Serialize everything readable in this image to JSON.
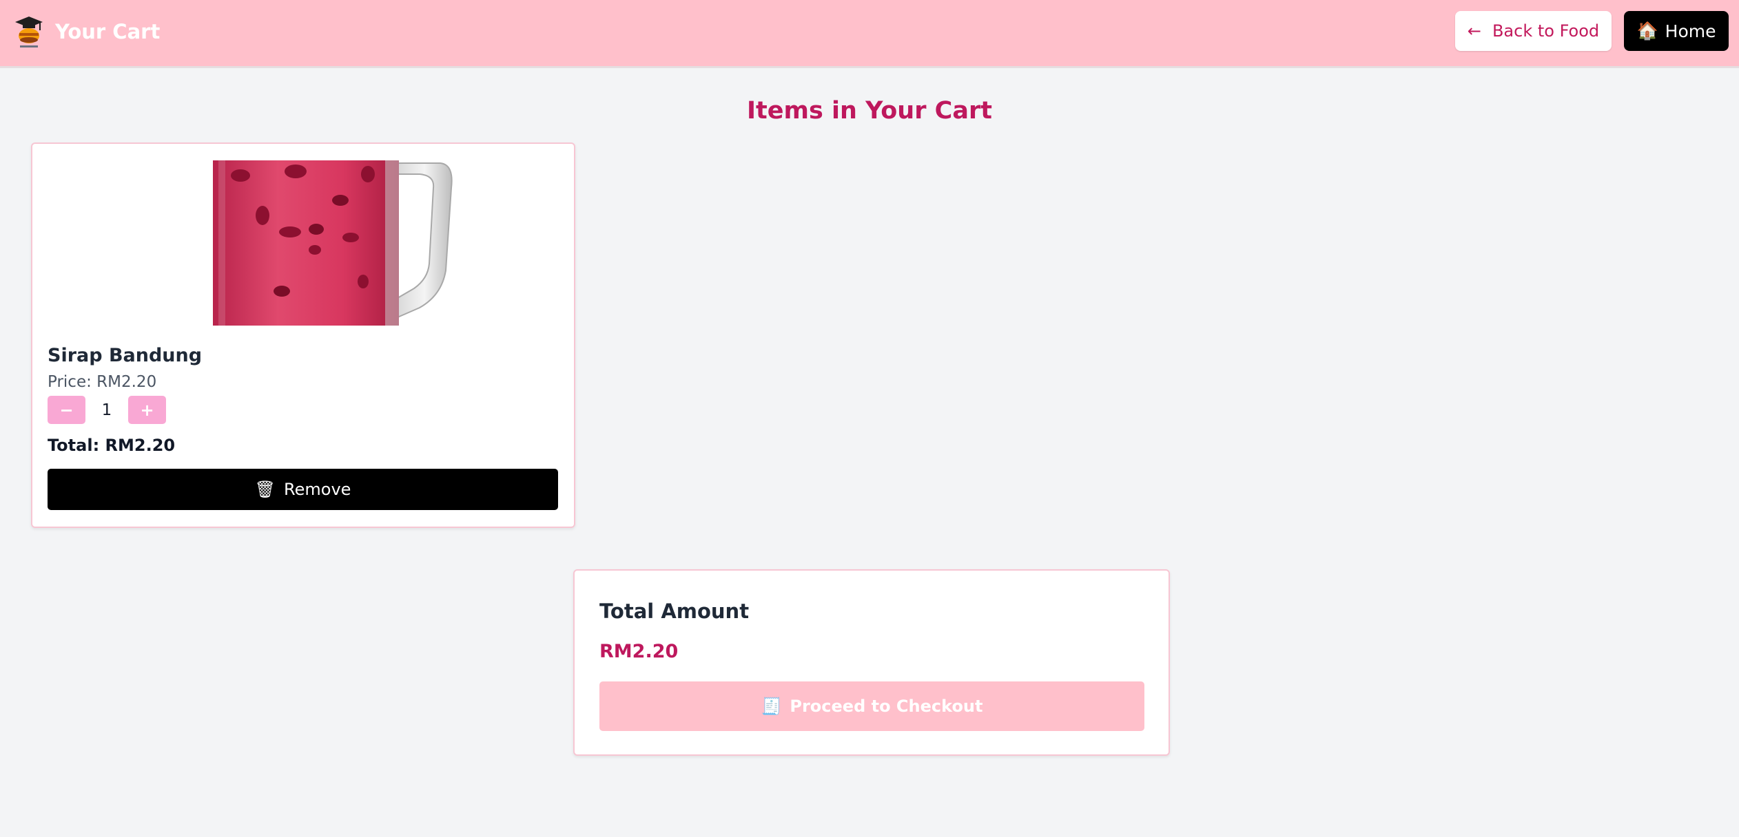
{
  "header": {
    "title": "Your Cart",
    "back_label": "Back to Food",
    "home_label": "Home",
    "home_icon": "🏠",
    "back_icon": "←"
  },
  "main": {
    "heading": "Items in Your Cart"
  },
  "cart": {
    "items": [
      {
        "name": "Sirap Bandung",
        "price": "Price: RM2.20",
        "quantity": "1",
        "minus_label": "−",
        "plus_label": "+",
        "total": "Total: RM2.20",
        "remove_label": "Remove",
        "remove_icon": "🗑"
      }
    ]
  },
  "summary": {
    "title": "Total Amount",
    "amount": "RM2.20",
    "checkout_label": "Proceed to Checkout",
    "checkout_icon": "🧾"
  },
  "colors": {
    "header_bg": "#ffc0cb",
    "accent": "#be185d",
    "qty_button": "#f9a8d4",
    "checkout_disabled": "#ffc0cb"
  }
}
